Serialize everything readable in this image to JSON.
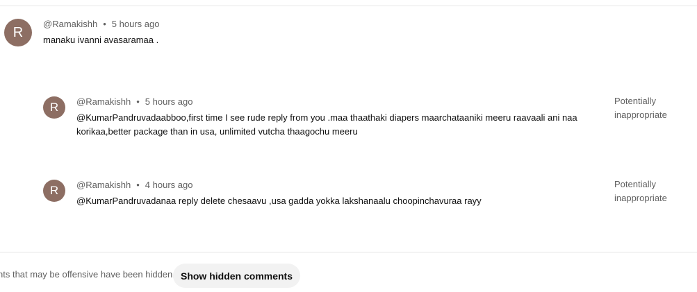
{
  "comments": [
    {
      "avatar_letter": "R",
      "author": "@Ramakishh",
      "separator": "•",
      "time": "5 hours ago",
      "text": "manaku ivanni avasaramaa .",
      "avatar_color": "#8d6e63"
    },
    {
      "avatar_letter": "R",
      "author": "@Ramakishh",
      "separator": "•",
      "time": "5 hours ago",
      "text_line1": "@KumarPandruvadaabboo,first time I see rude reply from you .maa thaathaki diapers maarchataaniki meeru raavaali ani naa",
      "text_line2": "korikaa,better package than in usa, unlimited vutcha thaagochu meeru",
      "flag_line1": "Potentially",
      "flag_line2": "inappropriate"
    },
    {
      "avatar_letter": "R",
      "author": "@Ramakishh",
      "separator": "•",
      "time": "4 hours ago",
      "text": "@KumarPandruvadanaa reply delete chesaavu ,usa gadda yokka lakshanaalu choopinchavuraa rayy",
      "flag_line1": "Potentially",
      "flag_line2": "inappropriate"
    }
  ],
  "footer": {
    "notice": "nts that may be offensive have been hidden.",
    "show_hidden_label": "Show hidden comments"
  }
}
